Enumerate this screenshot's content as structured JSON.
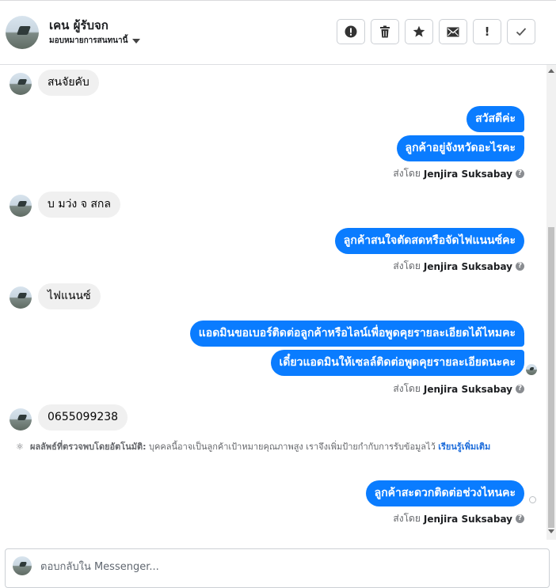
{
  "header": {
    "contact_name": "เคน ผู้รับจก",
    "assign_label": "มอบหมายการสนทนานี้",
    "actions": [
      {
        "icon": "alert-circle-icon"
      },
      {
        "icon": "trash-icon"
      },
      {
        "icon": "star-icon"
      },
      {
        "icon": "envelope-icon"
      },
      {
        "label": "!"
      },
      {
        "icon": "check-icon"
      }
    ]
  },
  "messages": {
    "m1": "สนจัยคับ",
    "m2": "สวัสดีค่ะ",
    "m3": "ลูกค้าอยู่จังหวัดอะไรคะ",
    "sent_prefix": "ส่งโดย",
    "agent": "Jenjira Suksabay",
    "m4": "บ มว่ง จ สกล",
    "m5": "ลูกค้าสนใจตัดสดหรือจัดไฟแนนซ์คะ",
    "m6": "ไฟแนนซ์",
    "m7": "แอดมินขอเบอร์ติดต่อลูกค้าหรือไลน์เพื่อพูดคุยรายละเอียดได้ไหมคะ",
    "m8": "เดี๋ยวแอดมินให้เซลล์ติดต่อพูดคุยรายละเอียดนะคะ",
    "m9": "0655099238",
    "m10": "ลูกค้าสะดวกติดต่อช่วงไหนคะ"
  },
  "auto_detect": {
    "label": "ผลลัพธ์ที่ตรวจพบโดยอัตโนมัติ:",
    "text": "บุคคลนี้อาจเป็นลูกค้าเป้าหมายคุณภาพสูง เราจึงเพิ่มป้ายกำกับการรับข้อมูลไว้",
    "link": "เรียนรู้เพิ่มเติม"
  },
  "reply": {
    "placeholder": "ตอบกลับใน Messenger..."
  },
  "colors": {
    "accent": "#0a7cff",
    "incoming_bubble": "#f0f0f0"
  }
}
